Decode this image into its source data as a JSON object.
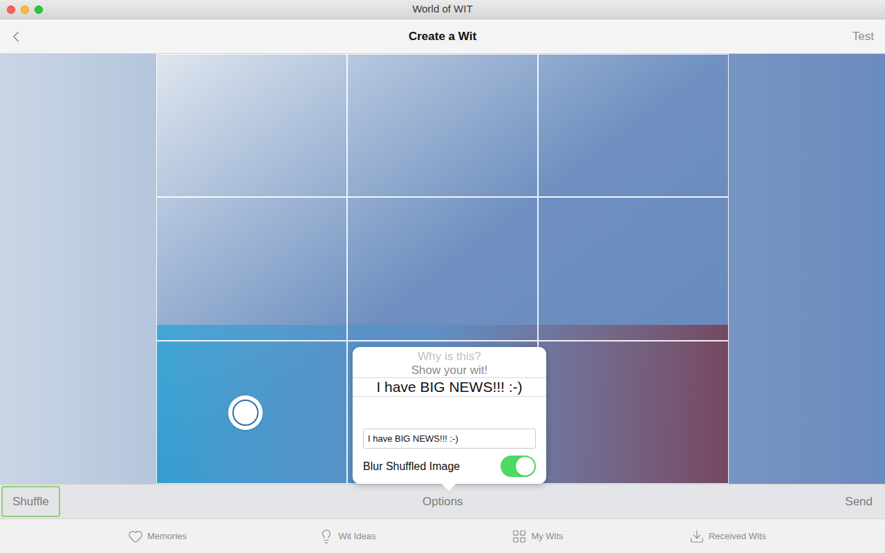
{
  "window": {
    "title": "World of WIT"
  },
  "toolbar": {
    "title": "Create a Wit",
    "action": "Test"
  },
  "popover": {
    "picker": [
      {
        "label": "Why is this?",
        "selected": false
      },
      {
        "label": "Show your wit!",
        "selected": false
      },
      {
        "label": "I have BIG NEWS!!! :-)",
        "selected": true
      }
    ],
    "field": {
      "value": "I have BIG NEWS!!! :-)"
    },
    "toggle": {
      "label": "Blur Shuffled Image",
      "on": true
    }
  },
  "actions": [
    {
      "label": "Shuffle",
      "focused": true
    },
    {
      "label": "Options",
      "focused": false
    },
    {
      "label": "Send",
      "focused": false
    }
  ],
  "tabs": [
    {
      "label": "Memories",
      "selected": false
    },
    {
      "label": "Wit Ideas",
      "selected": false
    },
    {
      "label": "My Wits",
      "selected": false
    },
    {
      "label": "Received Wits",
      "selected": false
    }
  ]
}
